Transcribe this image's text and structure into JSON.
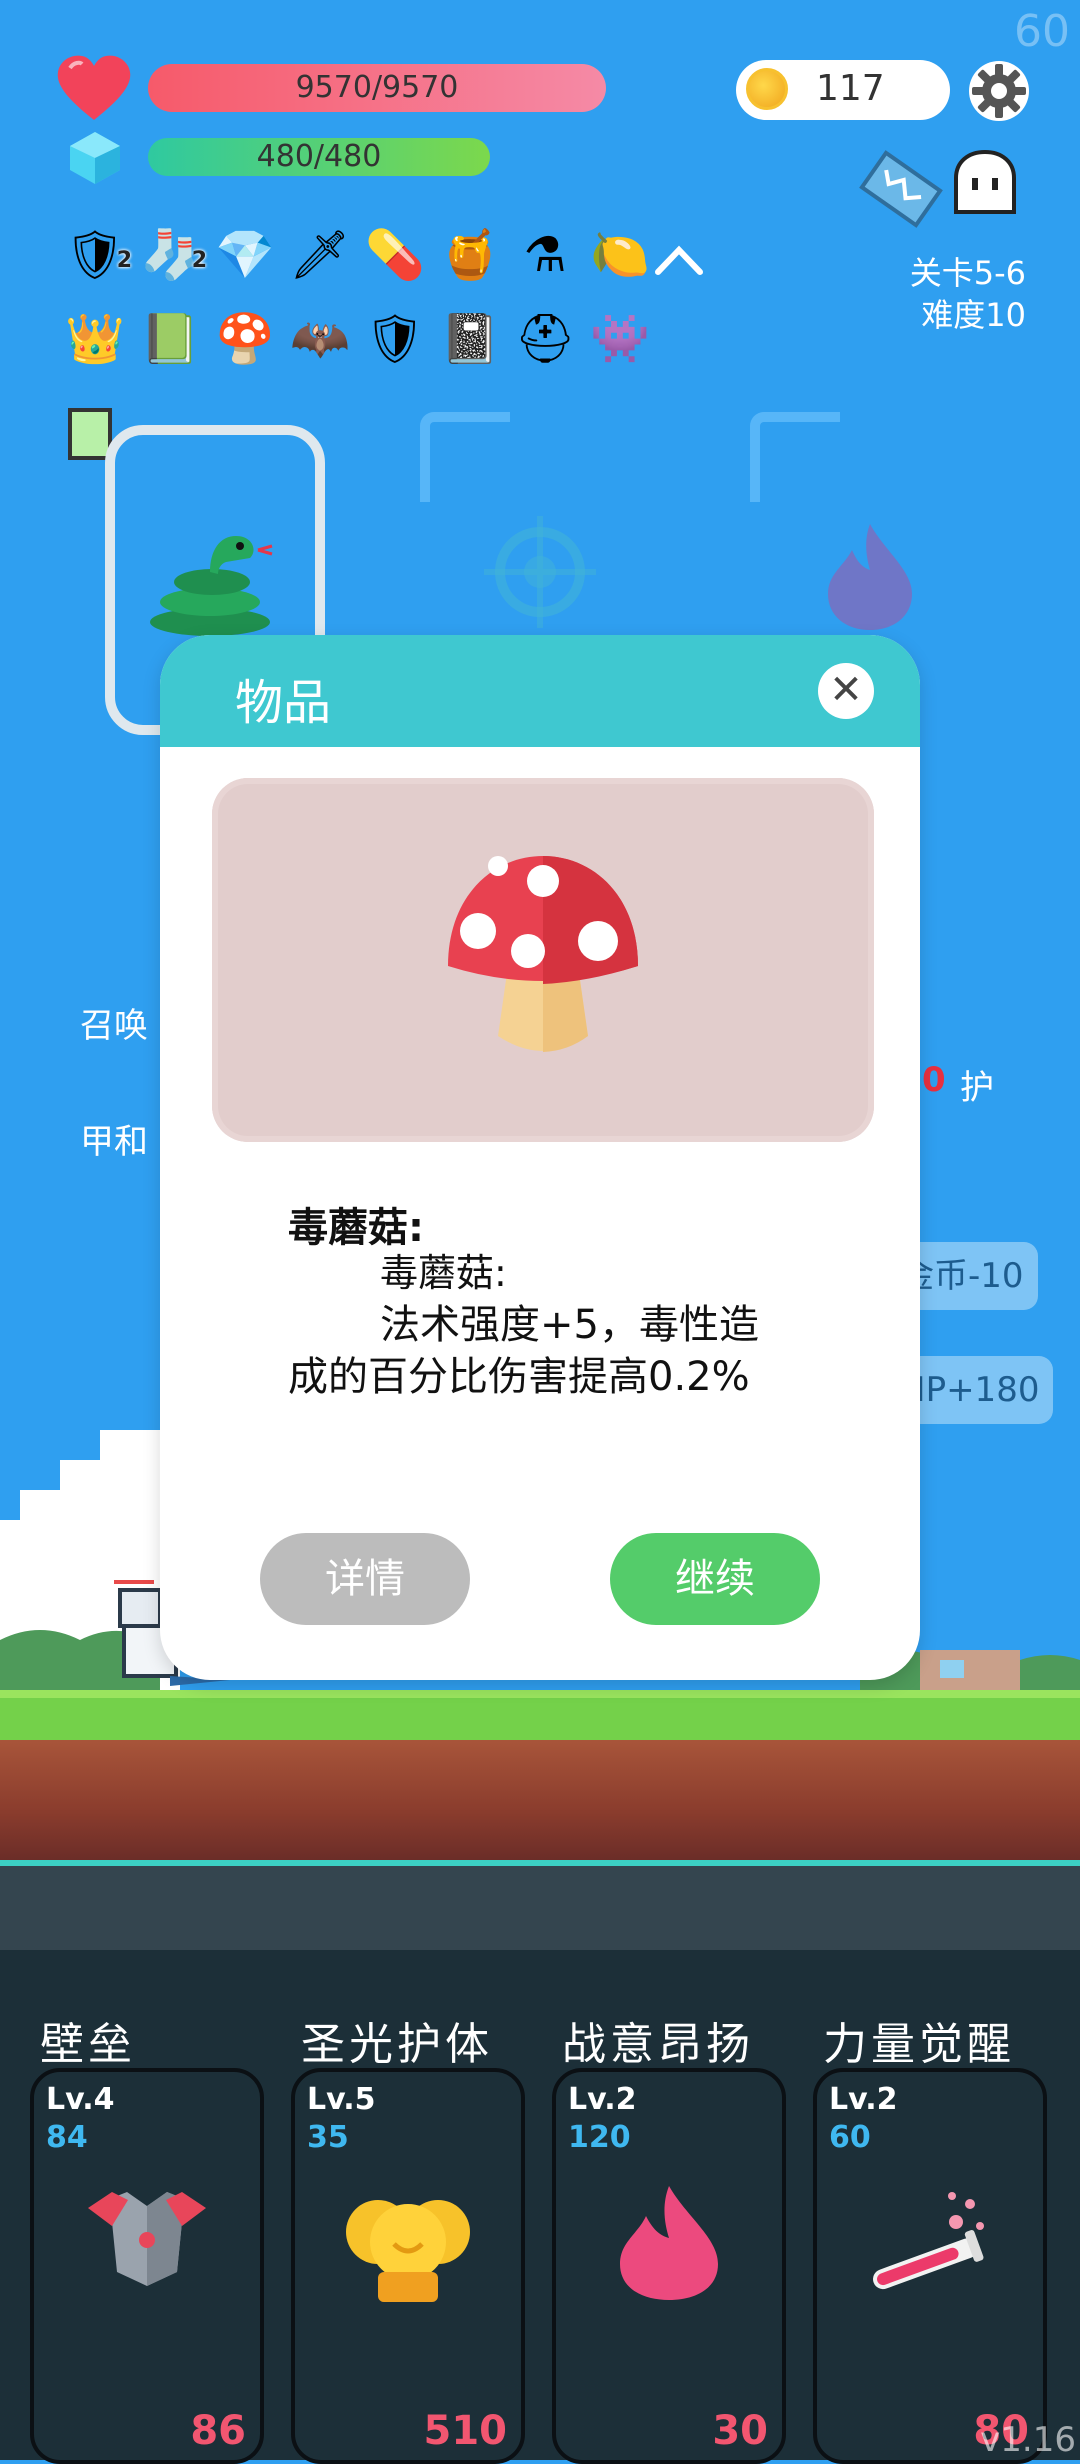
{
  "fps": "60",
  "hp": {
    "text": "9570/9570",
    "fraction": 1.0
  },
  "mp": {
    "text": "480/480",
    "fraction": 1.0
  },
  "gold": "117",
  "stage": {
    "level": "关卡5-6",
    "difficulty": "难度10"
  },
  "items_row1": [
    {
      "icon": "shield-icon",
      "glyph": "🛡",
      "badge": "2"
    },
    {
      "icon": "sock-icon",
      "glyph": "🧦",
      "badge": "2"
    },
    {
      "icon": "ruby-icon",
      "glyph": "💎",
      "badge": ""
    },
    {
      "icon": "sword-icon",
      "glyph": "🗡",
      "badge": ""
    },
    {
      "icon": "pill-icon",
      "glyph": "💊",
      "badge": ""
    },
    {
      "icon": "jam-jar-icon",
      "glyph": "🍯",
      "badge": ""
    },
    {
      "icon": "mortar-icon",
      "glyph": "⚗",
      "badge": ""
    },
    {
      "icon": "lime-icon",
      "glyph": "🍋",
      "badge": ""
    }
  ],
  "items_row2": [
    {
      "icon": "crown-icon",
      "glyph": "👑"
    },
    {
      "icon": "card-icon",
      "glyph": "📗"
    },
    {
      "icon": "mushroom-icon",
      "glyph": "🍄"
    },
    {
      "icon": "bat-icon",
      "glyph": "🦇"
    },
    {
      "icon": "blue-shield-icon",
      "glyph": "🛡"
    },
    {
      "icon": "skull-book-icon",
      "glyph": "📓"
    },
    {
      "icon": "helmet-icon",
      "glyph": "⛑"
    },
    {
      "icon": "zombie-icon",
      "glyph": "👾"
    }
  ],
  "background_texts": {
    "summon": "召唤",
    "armor": "甲和",
    "red_value": "0",
    "guard": "护",
    "gold_minus": "金币-10",
    "hp_plus": "HP+180"
  },
  "modal": {
    "title": "物品",
    "close": "✕",
    "item_name": "毒蘑菇:",
    "desc_line1": "毒蘑菇:",
    "desc_line2": "法术强度+5，毒性造",
    "desc_line3": "成的百分比伤害提高0.2%",
    "detail_button": "详情",
    "continue_button": "继续"
  },
  "skills": [
    {
      "name": "壁垒",
      "level": "Lv.4",
      "value": "84",
      "cost": "86",
      "icon": "armor-icon"
    },
    {
      "name": "圣光护体",
      "level": "Lv.5",
      "value": "35",
      "cost": "510",
      "icon": "holy-coins-icon"
    },
    {
      "name": "战意昂扬",
      "level": "Lv.2",
      "value": "120",
      "cost": "30",
      "icon": "flame-icon"
    },
    {
      "name": "力量觉醒",
      "level": "Lv.2",
      "value": "60",
      "cost": "80",
      "icon": "potion-tube-icon"
    }
  ],
  "version": "v1.16",
  "colors": {
    "sky": "#2f9ff0",
    "modal_header": "#3fc8d0",
    "continue": "#54cc6a",
    "cost": "#f25670"
  }
}
